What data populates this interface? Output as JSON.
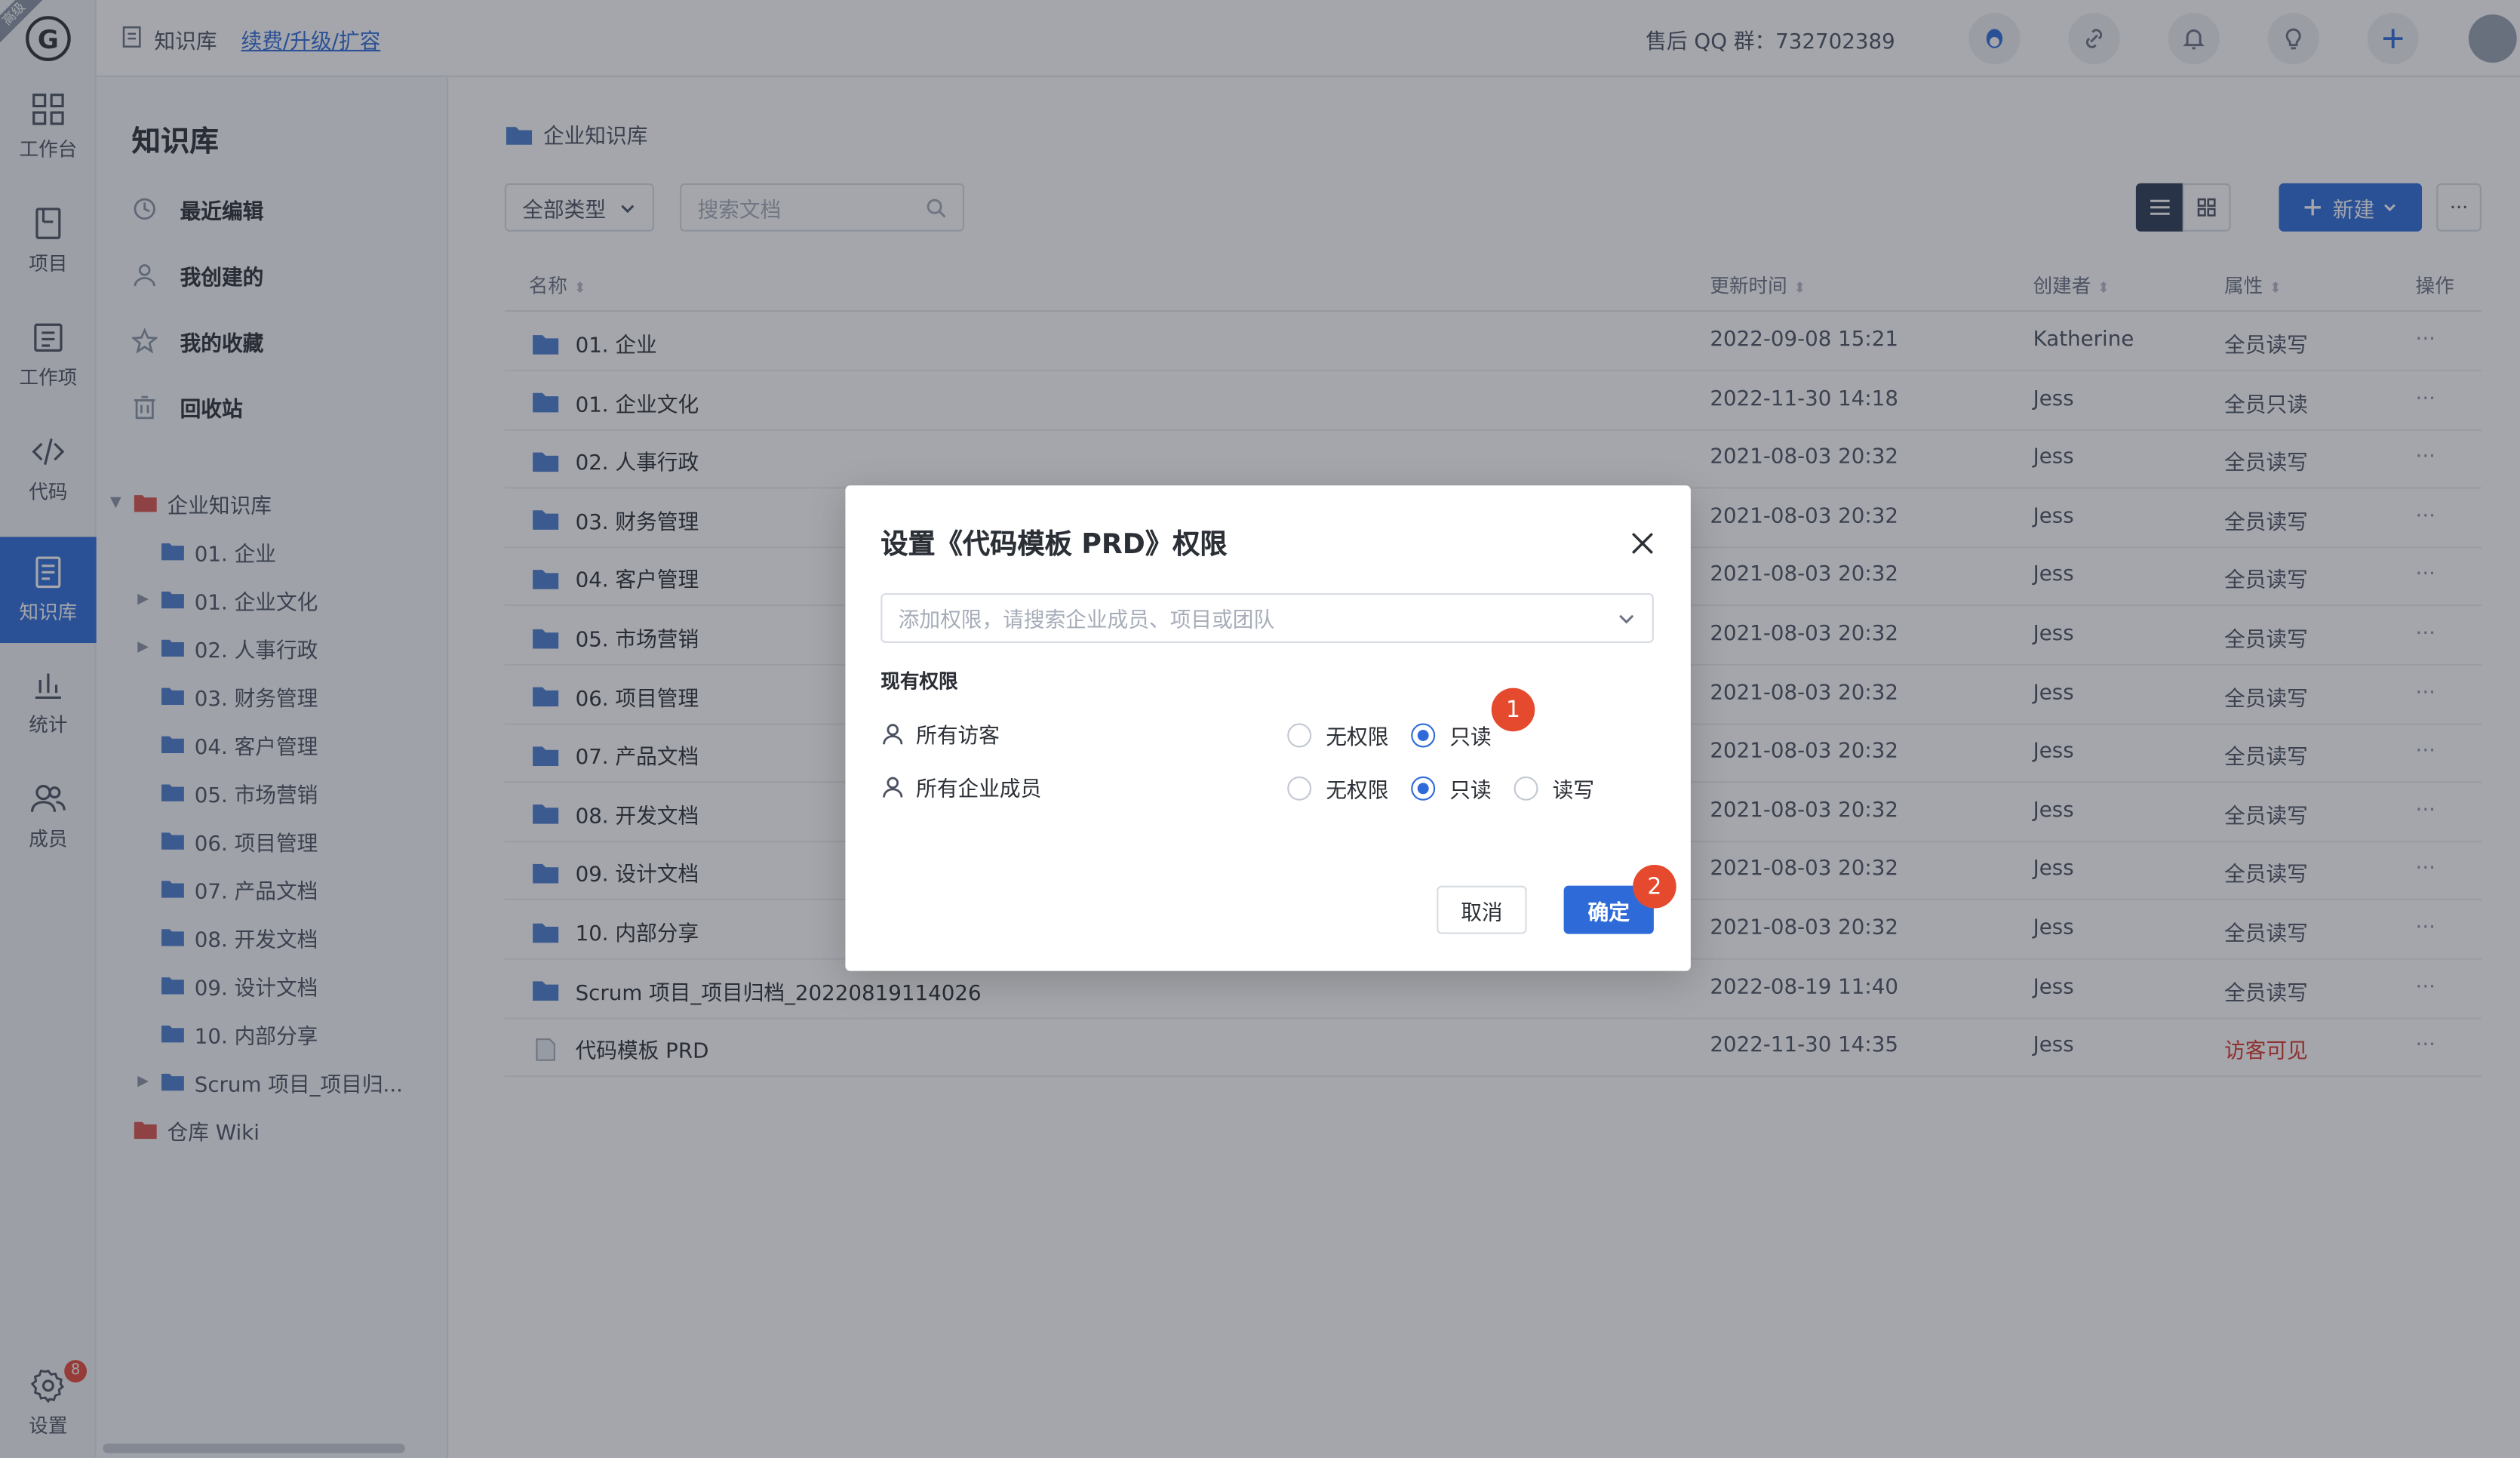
{
  "rail": {
    "ribbon": "高级",
    "logo": "G",
    "items": [
      {
        "label": "工作台",
        "icon": "workbench-icon"
      },
      {
        "label": "项目",
        "icon": "project-icon"
      },
      {
        "label": "工作项",
        "icon": "work-item-icon"
      },
      {
        "label": "代码",
        "icon": "code-icon"
      },
      {
        "label": "知识库",
        "icon": "knowledge-base-icon",
        "active": true
      },
      {
        "label": "统计",
        "icon": "stats-icon"
      },
      {
        "label": "成员",
        "icon": "members-icon"
      }
    ],
    "settings": {
      "label": "设置",
      "icon": "gear-icon",
      "badge": "8"
    }
  },
  "topbar": {
    "crumb": "知识库",
    "upgrade_link": "续费/升级/扩容",
    "qq_group": "售后 QQ 群：732702389"
  },
  "sidebar": {
    "title": "知识库",
    "links": [
      {
        "label": "最近编辑",
        "icon": "clock-icon"
      },
      {
        "label": "我创建的",
        "icon": "user-icon"
      },
      {
        "label": "我的收藏",
        "icon": "star-icon"
      },
      {
        "label": "回收站",
        "icon": "trash-icon"
      }
    ],
    "tree": [
      {
        "label": "企业知识库",
        "level": 0,
        "caret": "▼",
        "kind": "root"
      },
      {
        "label": "01. 企业",
        "level": 1,
        "caret": "",
        "kind": "folder"
      },
      {
        "label": "01. 企业文化",
        "level": 1,
        "caret": "▶",
        "kind": "folder"
      },
      {
        "label": "02. 人事行政",
        "level": 1,
        "caret": "▶",
        "kind": "folder"
      },
      {
        "label": "03. 财务管理",
        "level": 1,
        "caret": "",
        "kind": "folder"
      },
      {
        "label": "04. 客户管理",
        "level": 1,
        "caret": "",
        "kind": "folder"
      },
      {
        "label": "05. 市场营销",
        "level": 1,
        "caret": "",
        "kind": "folder"
      },
      {
        "label": "06. 项目管理",
        "level": 1,
        "caret": "",
        "kind": "folder"
      },
      {
        "label": "07. 产品文档",
        "level": 1,
        "caret": "",
        "kind": "folder"
      },
      {
        "label": "08. 开发文档",
        "level": 1,
        "caret": "",
        "kind": "folder"
      },
      {
        "label": "09. 设计文档",
        "level": 1,
        "caret": "",
        "kind": "folder"
      },
      {
        "label": "10. 内部分享",
        "level": 1,
        "caret": "",
        "kind": "folder"
      },
      {
        "label": "Scrum 项目_项目归...",
        "level": 1,
        "caret": "▶",
        "kind": "folder"
      },
      {
        "label": "仓库 Wiki",
        "level": 0,
        "caret": "",
        "kind": "wiki"
      }
    ]
  },
  "main": {
    "crumb": "企业知识库",
    "type_filter": "全部类型",
    "search_placeholder": "搜索文档",
    "new_button": "新建",
    "more_button": "···",
    "columns": {
      "name": "名称",
      "time": "更新时间",
      "creator": "创建者",
      "attr": "属性",
      "op": "操作"
    },
    "rows": [
      {
        "name": "01. 企业",
        "time": "2022-09-08 15:21",
        "creator": "Katherine",
        "attr": "全员读写",
        "type": "folder"
      },
      {
        "name": "01. 企业文化",
        "time": "2022-11-30 14:18",
        "creator": "Jess",
        "attr": "全员只读",
        "type": "folder"
      },
      {
        "name": "02. 人事行政",
        "time": "2021-08-03 20:32",
        "creator": "Jess",
        "attr": "全员读写",
        "type": "folder"
      },
      {
        "name": "03. 财务管理",
        "time": "2021-08-03 20:32",
        "creator": "Jess",
        "attr": "全员读写",
        "type": "folder"
      },
      {
        "name": "04. 客户管理",
        "time": "2021-08-03 20:32",
        "creator": "Jess",
        "attr": "全员读写",
        "type": "folder"
      },
      {
        "name": "05. 市场营销",
        "time": "2021-08-03 20:32",
        "creator": "Jess",
        "attr": "全员读写",
        "type": "folder"
      },
      {
        "name": "06. 项目管理",
        "time": "2021-08-03 20:32",
        "creator": "Jess",
        "attr": "全员读写",
        "type": "folder"
      },
      {
        "name": "07. 产品文档",
        "time": "2021-08-03 20:32",
        "creator": "Jess",
        "attr": "全员读写",
        "type": "folder"
      },
      {
        "name": "08. 开发文档",
        "time": "2021-08-03 20:32",
        "creator": "Jess",
        "attr": "全员读写",
        "type": "folder"
      },
      {
        "name": "09. 设计文档",
        "time": "2021-08-03 20:32",
        "creator": "Jess",
        "attr": "全员读写",
        "type": "folder"
      },
      {
        "name": "10. 内部分享",
        "time": "2021-08-03 20:32",
        "creator": "Jess",
        "attr": "全员读写",
        "type": "folder"
      },
      {
        "name": "Scrum 项目_项目归档_20220819114026",
        "time": "2022-08-19 11:40",
        "creator": "Jess",
        "attr": "全员读写",
        "type": "folder"
      },
      {
        "name": "代码模板 PRD",
        "time": "2022-11-30 14:35",
        "creator": "Jess",
        "attr": "访客可见",
        "type": "doc",
        "attr_red": true
      }
    ],
    "row_op": "···"
  },
  "modal": {
    "title": "设置《代码模板 PRD》权限",
    "placeholder": "添加权限，请搜索企业成员、项目或团队",
    "section": "现有权限",
    "permissions": [
      {
        "who": "所有访客",
        "options": [
          "无权限",
          "只读"
        ],
        "selected": "只读"
      },
      {
        "who": "所有企业成员",
        "options": [
          "无权限",
          "只读",
          "读写"
        ],
        "selected": "只读"
      }
    ],
    "cancel": "取消",
    "ok": "确定",
    "markers": [
      "1",
      "2"
    ]
  },
  "colors": {
    "accent": "#2e6bd9",
    "marker": "#e64a2e",
    "warn": "#d9362b"
  }
}
